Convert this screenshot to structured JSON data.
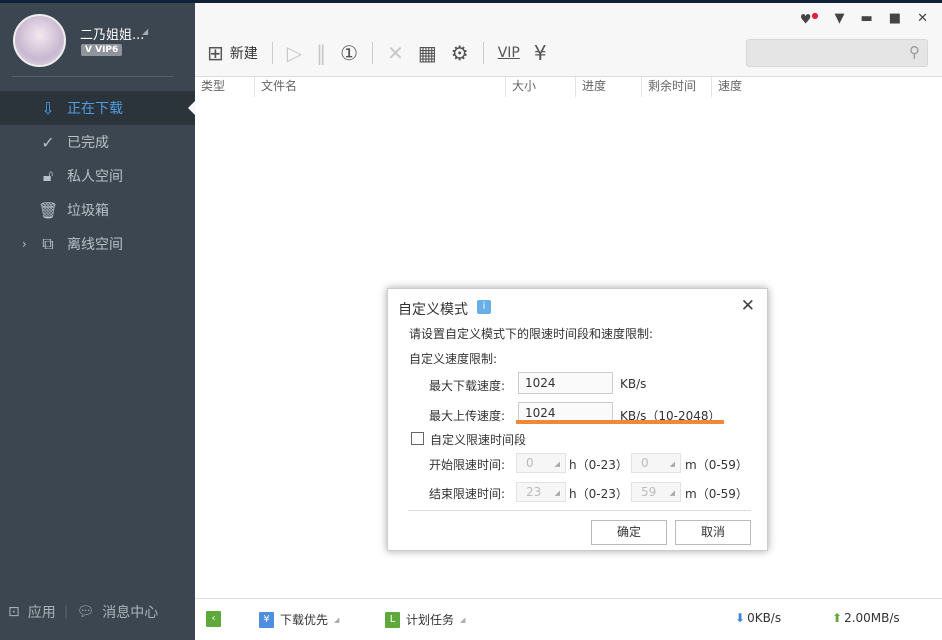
{
  "user": {
    "name": "二乃姐姐...",
    "vip": "VIP6"
  },
  "sidebar": {
    "items": [
      {
        "label": "正在下载",
        "icon": "download-arrow-icon"
      },
      {
        "label": "已完成",
        "icon": "check-circle-icon"
      },
      {
        "label": "私人空间",
        "icon": "lock-icon"
      },
      {
        "label": "垃圾箱",
        "icon": "trash-icon"
      },
      {
        "label": "离线空间",
        "icon": "cloud-download-icon"
      }
    ],
    "apps": "应用",
    "messages": "消息中心"
  },
  "toolbar": {
    "new_label": "新建"
  },
  "columns": [
    "类型",
    "文件名",
    "大小",
    "进度",
    "剩余时间",
    "速度"
  ],
  "status": {
    "priority": "下载优先",
    "schedule": "计划任务",
    "down_speed": "0KB/s",
    "up_speed": "2.00MB/s"
  },
  "dialog": {
    "title": "自定义模式",
    "desc": "请设置自定义模式下的限速时间段和速度限制:",
    "section": "自定义速度限制:",
    "max_down_label": "最大下载速度:",
    "max_down": "1024",
    "max_down_unit": "KB/s",
    "max_up_label": "最大上传速度:",
    "max_up": "1024",
    "max_up_unit": "KB/s（10-2048）",
    "schedule_check": "自定义限速时间段",
    "schedule_checked": false,
    "start_label": "开始限速时间:",
    "start_h": "0",
    "start_m": "0",
    "end_label": "结束限速时间:",
    "end_h": "23",
    "end_m": "59",
    "h_range": "h（0-23）",
    "m_range": "m（0-59）",
    "ok": "确定",
    "cancel": "取消"
  },
  "colors": {
    "sidebar": "#3c4650",
    "accent": "#4f9ee2",
    "highlight": "#f0883a"
  }
}
